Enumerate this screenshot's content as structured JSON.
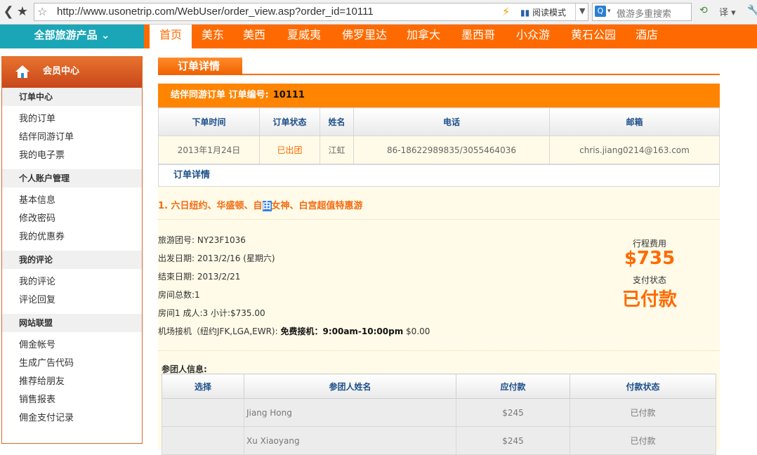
{
  "browser": {
    "url": "http://www.usonetrip.com/WebUser/order_view.asp?order_id=10111",
    "read_mode": "阅读模式",
    "search_placeholder": "傲游多重搜索",
    "translate_label": "译"
  },
  "topnav": {
    "all_products": "全部旅游产品 ⌄",
    "items": [
      "首页",
      "美东",
      "美西",
      "夏威夷",
      "佛罗里达",
      "加拿大",
      "墨西哥",
      "小众游",
      "黄石公园",
      "酒店"
    ],
    "active": "首页"
  },
  "sidebar": {
    "header": "会员中心",
    "sections": [
      {
        "title": "订单中心",
        "items": [
          "我的订单",
          "结伴同游订单",
          "我的电子票"
        ]
      },
      {
        "title": "个人账户管理",
        "items": [
          "基本信息",
          "修改密码",
          "我的优惠券"
        ]
      },
      {
        "title": "我的评论",
        "items": [
          "我的评论",
          "评论回复"
        ]
      },
      {
        "title": "网站联盟",
        "items": [
          "佣金帐号",
          "生成广告代码",
          "推荐给朋友",
          "销售报表",
          "佣金支付记录"
        ]
      }
    ]
  },
  "main": {
    "tab_title": "订单详情",
    "order_bar_label": "结伴同游订单 订单编号:",
    "order_number": "10111",
    "order_table": {
      "headers": [
        "下单时间",
        "订单状态",
        "姓名",
        "电话",
        "邮箱"
      ],
      "row": [
        "2013年1月24日",
        "已出团",
        "江虹",
        "86-18622989835/3055464036",
        "chris.jiang0214@163.com"
      ]
    },
    "detail_subtitle": "订单详情",
    "tour_name_pre": "1. 六日纽约、华盛顿、自",
    "tour_name_hl": "由",
    "tour_name_post": "女神、白宫超值特惠游",
    "info": {
      "group_no": "旅游团号: NY23F1036",
      "depart": "出发日期: 2013/2/16 (星期六)",
      "end": "结束日期: 2013/2/21",
      "rooms": "房间总数:1",
      "room1": "房间1 成人:3 小计:$735.00",
      "transfer_pre": "机场接机（纽约JFK,LGA,EWR):",
      "transfer_bold": "免费接机：9:00am-10:00pm",
      "transfer_price": "$0.00"
    },
    "price_label": "行程费用",
    "price": "$735",
    "pay_status_label": "支付状态",
    "pay_status": "已付款",
    "members_label": "参团人信息:",
    "members_table": {
      "headers": [
        "选择",
        "参团人姓名",
        "应付款",
        "付款状态"
      ],
      "rows": [
        [
          "",
          "Jiang Hong",
          "$245",
          "已付款"
        ],
        [
          "",
          "Xu Xiaoyang",
          "$245",
          "已付款"
        ]
      ]
    }
  }
}
